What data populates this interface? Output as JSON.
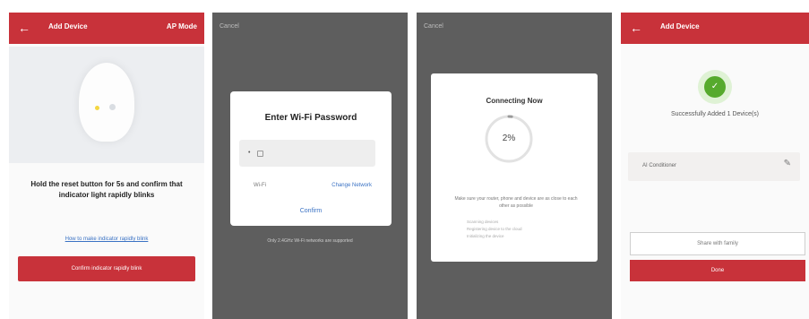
{
  "screen1": {
    "header_title": "Add Device",
    "header_right": "AP Mode",
    "back_icon": "arrow-left-icon",
    "instruction": "Hold the reset button for 5s and confirm that indicator light rapidly blinks",
    "help_link": "How to make indicator rapidly blink",
    "confirm_button": "Confirm indicator rapidly blink"
  },
  "screen2": {
    "top_text": "Cancel",
    "dialog_title": "Enter Wi-Fi Password",
    "password_value": "•",
    "wifi_label": "Wi-Fi",
    "change_network": "Change Network",
    "confirm": "Confirm",
    "footer_note": "Only 2.4GHz Wi-Fi networks are supported"
  },
  "screen3": {
    "top_text": "Cancel",
    "card_title": "Connecting Now",
    "progress_percent": 2,
    "progress_text": "2%",
    "hint": "Make sure your router, phone and device are as close to each other as possible",
    "steps": [
      "Scanning devices",
      "Registering device to the cloud",
      "Initializing the device"
    ]
  },
  "screen4": {
    "header_title": "Add Device",
    "back_icon": "arrow-left-icon",
    "check_icon": "check-icon",
    "success_text": "Successfully Added 1 Device(s)",
    "device_name": "AI Conditioner",
    "edit_icon": "pencil-icon",
    "share_button": "Share with family",
    "done_button": "Done"
  },
  "colors": {
    "accent": "#c8323a",
    "dark_bg": "#5e5e5e",
    "link": "#3a72c4",
    "success": "#56aa2d"
  }
}
